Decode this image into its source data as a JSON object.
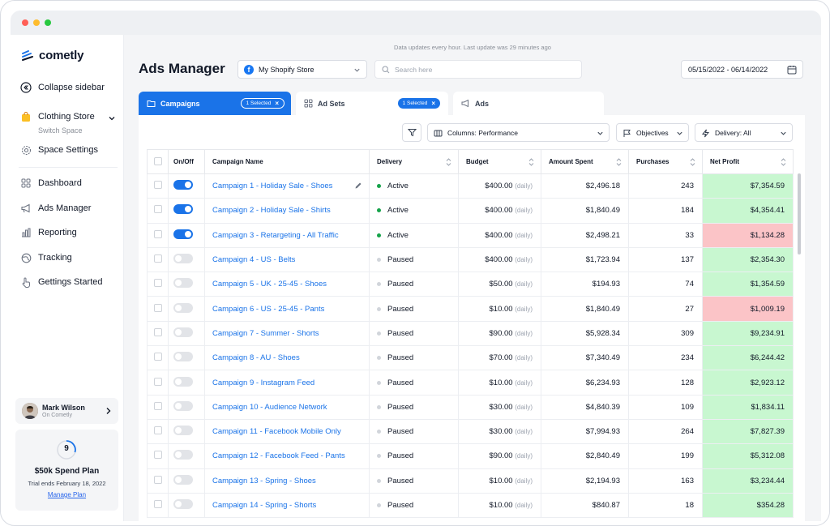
{
  "brand": {
    "name": "cometly"
  },
  "sidebar": {
    "collapse_label": "Collapse sidebar",
    "space": {
      "name": "Clothing Store",
      "switch_label": "Switch Space"
    },
    "space_settings": "Space Settings",
    "nav": [
      {
        "label": "Dashboard",
        "icon": "grid-icon"
      },
      {
        "label": "Ads Manager",
        "icon": "megaphone-icon"
      },
      {
        "label": "Reporting",
        "icon": "bar-chart-icon"
      },
      {
        "label": "Tracking",
        "icon": "globe-icon"
      },
      {
        "label": "Gettings Started",
        "icon": "pointer-icon"
      }
    ],
    "user": {
      "name": "Mark Wilson",
      "subtitle": "On Cometly"
    },
    "plan": {
      "number": "9",
      "title": "$50k Spend Plan",
      "trial": "Trial ends February 18, 2022",
      "link": "Manage Plan"
    }
  },
  "header": {
    "update_note": "Data updates every hour. Last update was 29 minutes ago",
    "title": "Ads Manager",
    "store": "My Shopify Store",
    "search_placeholder": "Search here",
    "date_range": "05/15/2022 - 06/14/2022"
  },
  "tabs": {
    "campaigns": {
      "label": "Campaigns",
      "badge": "1 Selected"
    },
    "adsets": {
      "label": "Ad Sets",
      "badge": "1 Selected"
    },
    "ads": {
      "label": "Ads"
    }
  },
  "toolbar": {
    "columns": "Columns: Performance",
    "objectives": "Objectives",
    "delivery": "Delivery: All"
  },
  "table": {
    "headers": {
      "onoff": "On/Off",
      "name": "Campaign Name",
      "delivery": "Delivery",
      "budget": "Budget",
      "spent": "Amount Spent",
      "purchases": "Purchases",
      "profit": "Net Profit"
    },
    "daily_label": "(daily)",
    "rows": [
      {
        "name": "Campaign 1 - Holiday Sale - Shoes",
        "on": true,
        "delivery": "Active",
        "budget": "$400.00",
        "spent": "$2,496.18",
        "purchases": "243",
        "profit": "$7,354.59",
        "positive": true
      },
      {
        "name": "Campaign 2 - Holiday Sale - Shirts",
        "on": true,
        "delivery": "Active",
        "budget": "$400.00",
        "spent": "$1,840.49",
        "purchases": "184",
        "profit": "$4,354.41",
        "positive": true
      },
      {
        "name": "Campaign 3 - Retargeting - All Traffic",
        "on": true,
        "delivery": "Active",
        "budget": "$400.00",
        "spent": "$2,498.21",
        "purchases": "33",
        "profit": "$1,134.28",
        "positive": false
      },
      {
        "name": "Campaign 4 - US - Belts",
        "on": false,
        "delivery": "Paused",
        "budget": "$400.00",
        "spent": "$1,723.94",
        "purchases": "137",
        "profit": "$2,354.30",
        "positive": true
      },
      {
        "name": "Campaign 5 - UK - 25-45 - Shoes",
        "on": false,
        "delivery": "Paused",
        "budget": "$50.00",
        "spent": "$194.93",
        "purchases": "74",
        "profit": "$1,354.59",
        "positive": true
      },
      {
        "name": "Campaign 6 - US - 25-45 - Pants",
        "on": false,
        "delivery": "Paused",
        "budget": "$10.00",
        "spent": "$1,840.49",
        "purchases": "27",
        "profit": "$1,009.19",
        "positive": false
      },
      {
        "name": "Campaign 7 - Summer - Shorts",
        "on": false,
        "delivery": "Paused",
        "budget": "$90.00",
        "spent": "$5,928.34",
        "purchases": "309",
        "profit": "$9,234.91",
        "positive": true
      },
      {
        "name": "Campaign 8 - AU - Shoes",
        "on": false,
        "delivery": "Paused",
        "budget": "$70.00",
        "spent": "$7,340.49",
        "purchases": "234",
        "profit": "$6,244.42",
        "positive": true
      },
      {
        "name": "Campaign 9 - Instagram Feed",
        "on": false,
        "delivery": "Paused",
        "budget": "$10.00",
        "spent": "$6,234.93",
        "purchases": "128",
        "profit": "$2,923.12",
        "positive": true
      },
      {
        "name": "Campaign 10 - Audience Network",
        "on": false,
        "delivery": "Paused",
        "budget": "$30.00",
        "spent": "$4,840.39",
        "purchases": "109",
        "profit": "$1,834.11",
        "positive": true
      },
      {
        "name": "Campaign 11 - Facebook Mobile Only",
        "on": false,
        "delivery": "Paused",
        "budget": "$30.00",
        "spent": "$7,994.93",
        "purchases": "264",
        "profit": "$7,827.39",
        "positive": true
      },
      {
        "name": "Campaign 12 - Facebook Feed - Pants",
        "on": false,
        "delivery": "Paused",
        "budget": "$90.00",
        "spent": "$2,840.49",
        "purchases": "199",
        "profit": "$5,312.08",
        "positive": true
      },
      {
        "name": "Campaign 13 - Spring - Shoes",
        "on": false,
        "delivery": "Paused",
        "budget": "$10.00",
        "spent": "$2,194.93",
        "purchases": "163",
        "profit": "$3,234.44",
        "positive": true
      },
      {
        "name": "Campaign 14 - Spring - Shorts",
        "on": false,
        "delivery": "Paused",
        "budget": "$10.00",
        "spent": "$840.87",
        "purchases": "18",
        "profit": "$354.28",
        "positive": true
      }
    ]
  },
  "colors": {
    "accent": "#1a73e8",
    "profit_positive": "#c8f7d0",
    "profit_negative": "#fbc4c7",
    "active": "#16a34a"
  }
}
